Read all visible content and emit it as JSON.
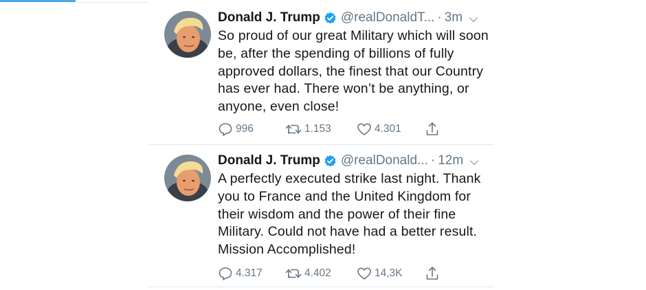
{
  "colors": {
    "accent": "#1da1f2",
    "secondary_text": "#657786",
    "divider": "#e1e8ed",
    "progress": "#4aa5e6"
  },
  "tweets": [
    {
      "name": "Donald J. Trump",
      "handle": "@realDonaldT...",
      "separator": "·",
      "time": "3m",
      "text": "So proud of our great Military which will soon be, after the spending of billions of fully approved dollars, the finest that our Country has ever had. There won’t be anything, or anyone, even close!",
      "replies": "996",
      "retweets": "1.153",
      "likes": "4.301"
    },
    {
      "name": "Donald J. Trump",
      "handle": "@realDonald...",
      "separator": "·",
      "time": "12m",
      "text": "A perfectly executed strike last night. Thank you to France and the United Kingdom for their wisdom and the power of their fine Military. Could not have had a better result. Mission Accomplished!",
      "replies": "4.317",
      "retweets": "4.402",
      "likes": "14,3K"
    }
  ],
  "icons": {
    "avatar": "avatar-photo",
    "verified": "verified-badge-icon",
    "menu": "chevron-down-icon",
    "reply": "reply-icon",
    "retweet": "retweet-icon",
    "like": "heart-icon",
    "share": "share-icon"
  }
}
